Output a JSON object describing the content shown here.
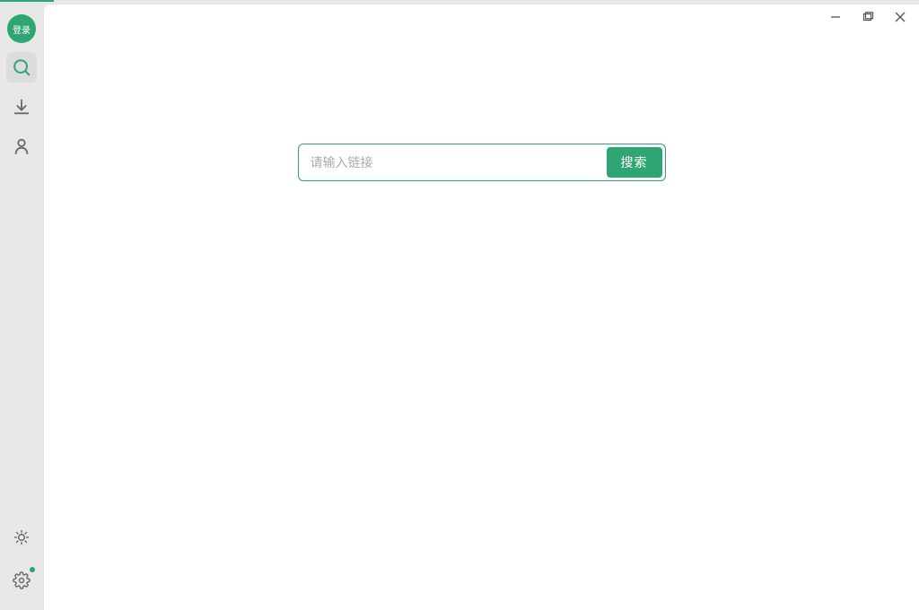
{
  "sidebar": {
    "login_label": "登录"
  },
  "search": {
    "placeholder": "请输入链接",
    "button_label": "搜索"
  },
  "colors": {
    "accent": "#2fa574"
  }
}
